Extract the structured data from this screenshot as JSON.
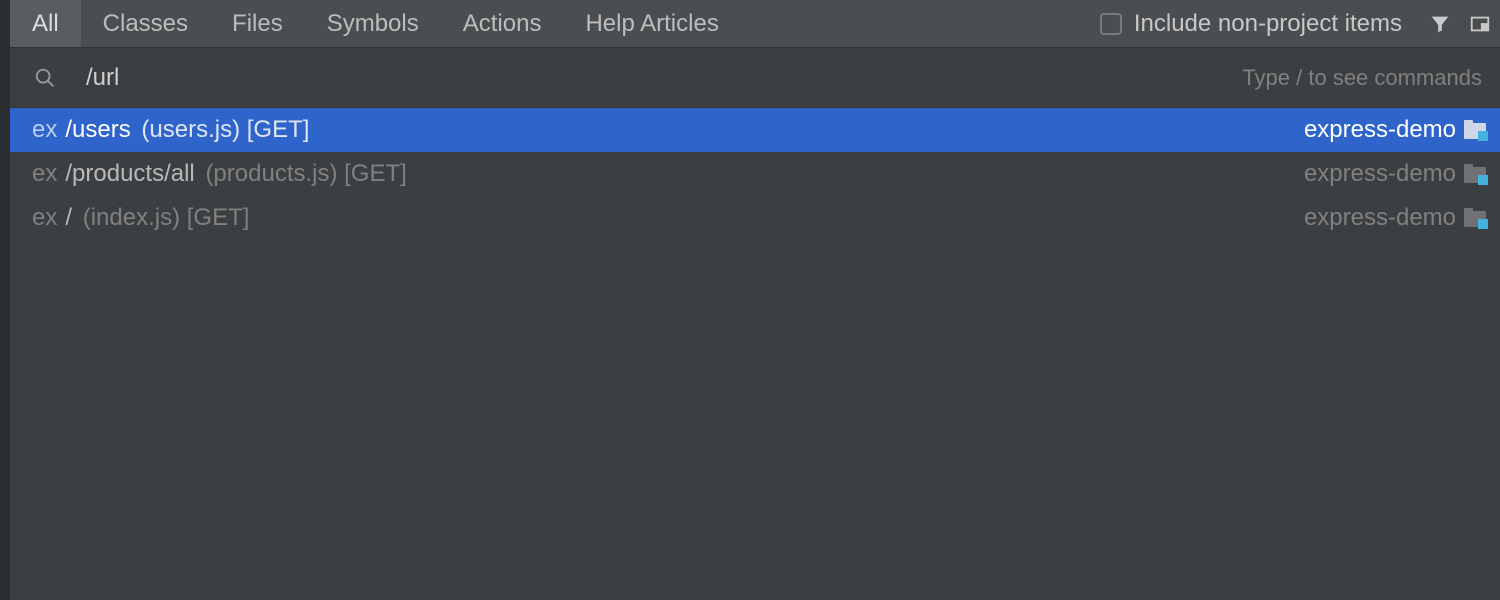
{
  "tabs": [
    {
      "label": "All",
      "active": true
    },
    {
      "label": "Classes",
      "active": false
    },
    {
      "label": "Files",
      "active": false
    },
    {
      "label": "Symbols",
      "active": false
    },
    {
      "label": "Actions",
      "active": false
    },
    {
      "label": "Help Articles",
      "active": false
    }
  ],
  "checkbox": {
    "label": "Include non-project items",
    "checked": false
  },
  "search": {
    "value": "/url",
    "hint": "Type / to see commands"
  },
  "results": [
    {
      "badge": "ex",
      "primary": "/users",
      "secondary": "(users.js) [GET]",
      "project": "express-demo",
      "selected": true
    },
    {
      "badge": "ex",
      "primary": "/products/all",
      "secondary": "(products.js) [GET]",
      "project": "express-demo",
      "selected": false
    },
    {
      "badge": "ex",
      "primary": "/",
      "secondary": "(index.js) [GET]",
      "project": "express-demo",
      "selected": false
    }
  ]
}
